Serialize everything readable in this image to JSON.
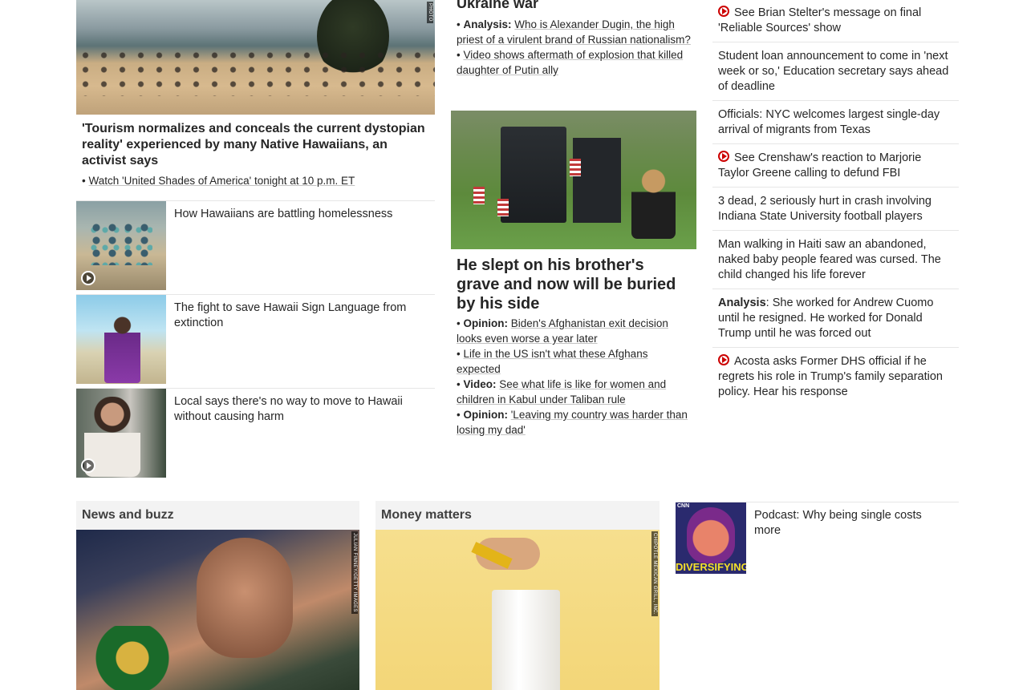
{
  "col1": {
    "hero_credit": "PHOTO",
    "hero_title": "'Tourism normalizes and conceals the current dystopian reality' experienced by many Native Hawaiians, an activist says",
    "hero_bullet": "Watch 'United Shades of America' tonight at 10 p.m. ET",
    "rows": [
      {
        "label": "How Hawaiians are battling homelessness"
      },
      {
        "label": "The fight to save Hawaii Sign Language from extinction"
      },
      {
        "label": "Local says there's no way to move to Hawaii without causing harm"
      }
    ]
  },
  "col2": {
    "top_heading": "Ukraine war",
    "top_bullets": [
      {
        "prefix": "Analysis:",
        "text": "Who is Alexander Dugin, the high priest of a virulent brand of Russian nationalism?"
      },
      {
        "prefix": "",
        "text": "Video shows aftermath of explosion that killed daughter of Putin ally"
      }
    ],
    "main_title": "He slept on his brother's grave and now will be buried by his side",
    "main_bullets": [
      {
        "prefix": "Opinion:",
        "text": "Biden's Afghanistan exit decision looks even worse a year later"
      },
      {
        "prefix": "",
        "text": "Life in the US isn't what these Afghans expected"
      },
      {
        "prefix": "Video:",
        "text": "See what life is like for women and children in Kabul under Taliban rule"
      },
      {
        "prefix": "Opinion:",
        "text": "'Leaving my country was harder than losing my dad'"
      }
    ]
  },
  "col3": {
    "items": [
      {
        "video": true,
        "prefix": "",
        "text": "See Brian Stelter's message on final 'Reliable Sources' show"
      },
      {
        "video": false,
        "prefix": "",
        "text": "Student loan announcement to come in 'next week or so,' Education secretary says ahead of deadline"
      },
      {
        "video": false,
        "prefix": "",
        "text": "Officials: NYC welcomes largest single-day arrival of migrants from Texas"
      },
      {
        "video": true,
        "prefix": "",
        "text": "See Crenshaw's reaction to Marjorie Taylor Greene calling to defund FBI"
      },
      {
        "video": false,
        "prefix": "",
        "text": "3 dead, 2 seriously hurt in crash involving Indiana State University football players"
      },
      {
        "video": false,
        "prefix": "",
        "text": "Man walking in Haiti saw an abandoned, naked baby people feared was cursed. The child changed his life forever"
      },
      {
        "video": false,
        "prefix": "Analysis",
        "text": ": She worked for Andrew Cuomo until he resigned. He worked for Donald Trump until he was forced out"
      },
      {
        "video": true,
        "prefix": "",
        "text": "Acosta asks Former DHS official if he regrets his role in Trump's family separation policy. Hear his response"
      }
    ]
  },
  "bottom": {
    "news_head": "News and buzz",
    "news_credit": "JULIAN FINNEY/GETTY IMAGES",
    "money_head": "Money matters",
    "money_credit": "CHIPOTLE MEXICAN GRILL, INC.",
    "podcast_label": "Podcast: Why being single costs more",
    "podcast_art_text": "DIVERSIFYING",
    "podcast_art_brand": "CNN"
  }
}
